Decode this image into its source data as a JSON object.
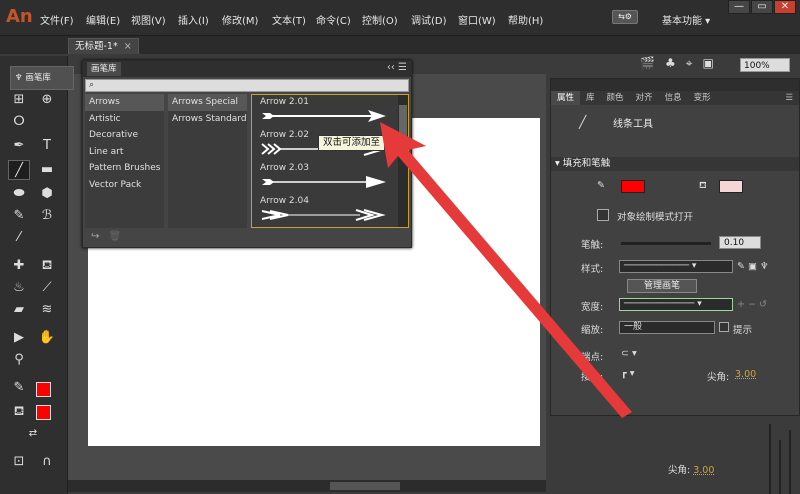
{
  "app": {
    "logo": "An"
  },
  "menu": {
    "items": [
      "文件(F)",
      "编辑(E)",
      "视图(V)",
      "插入(I)",
      "修改(M)",
      "文本(T)",
      "命令(C)",
      "控制(O)",
      "调试(D)",
      "窗口(W)",
      "帮助(H)"
    ],
    "workspace": "基本功能"
  },
  "window_buttons": {
    "minimize": "—",
    "restore": "▭",
    "close": "✕"
  },
  "document": {
    "tab_title": "无标题-1*",
    "tab_close": "×",
    "zoom": "100%"
  },
  "brush_library_tab": {
    "label": "画笔库"
  },
  "brush_panel": {
    "title": "画笔库",
    "collapse": "‹‹",
    "menu": "☰",
    "search_icon": "⌕",
    "categories": [
      "Arrows",
      "Artistic",
      "Decorative",
      "Line art",
      "Pattern Brushes",
      "Vector Pack"
    ],
    "selected_category": "Arrows",
    "subcategories": [
      "Arrows Special",
      "Arrows Standard"
    ],
    "selected_subcategory": "Arrows Special",
    "brushes": [
      "Arrow 2.01",
      "Arrow 2.02",
      "Arrow 2.03",
      "Arrow 2.04"
    ],
    "tooltip": "双击可添加至"
  },
  "properties": {
    "tabs": [
      "属性",
      "库",
      "颜色",
      "对齐",
      "信息",
      "变形"
    ],
    "active_tab": "属性",
    "tool_name": "线条工具",
    "section_fill_stroke": "填充和笔触",
    "stroke_color": "#ff0000",
    "object_draw_mode": "对象绘制模式打开",
    "stroke_label": "笔触:",
    "stroke_value": "0.10",
    "style_label": "样式:",
    "manage_brushes": "管理画笔",
    "width_label": "宽度:",
    "scale_label": "缩放:",
    "scale_value": "一般",
    "hint_label": "提示",
    "cap_label": "端点:",
    "join_label": "接合:",
    "miter_label": "尖角:",
    "miter_value": "3.00"
  },
  "status": {
    "miter_label": "尖角:",
    "miter_value": "3.00"
  },
  "colors": {
    "accent_red": "#ff0000",
    "highlight_border": "#c8a030",
    "annotation_arrow": "#e63a3a"
  }
}
